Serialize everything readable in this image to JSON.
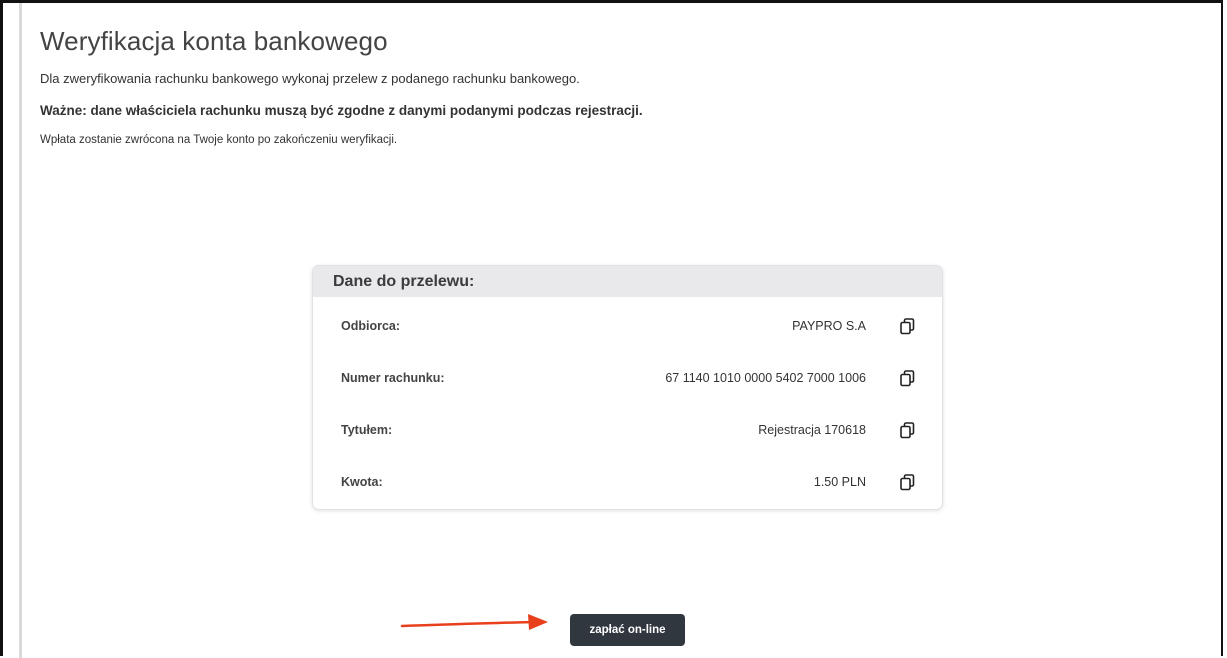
{
  "page": {
    "title": "Weryfikacja konta bankowego",
    "intro": "Dla zweryfikowania rachunku bankowego wykonaj przelew z podanego rachunku bankowego.",
    "important": "Ważne: dane właściciela rachunku muszą być zgodne z danymi podanymi podczas rejestracji.",
    "refund": "Wpłata zostanie zwrócona na Twoje konto po zakończeniu weryfikacji."
  },
  "card": {
    "header": "Dane do przelewu:",
    "rows": [
      {
        "label": "Odbiorca:",
        "value": "PAYPRO S.A",
        "icon": "copy-icon"
      },
      {
        "label": "Numer rachunku:",
        "value": "67 1140 1010 0000 5402 7000 1006",
        "icon": "copy-icon"
      },
      {
        "label": "Tytułem:",
        "value": "Rejestracja 170618",
        "icon": "copy-icon"
      },
      {
        "label": "Kwota:",
        "value": "1.50 PLN",
        "icon": "copy-icon"
      }
    ]
  },
  "actions": {
    "pay_label": "zapłać on-line"
  },
  "annotation": {
    "arrow_color": "#e8401c"
  },
  "colors": {
    "button_bg": "#30373f",
    "card_header_bg": "#e9e9ec"
  }
}
